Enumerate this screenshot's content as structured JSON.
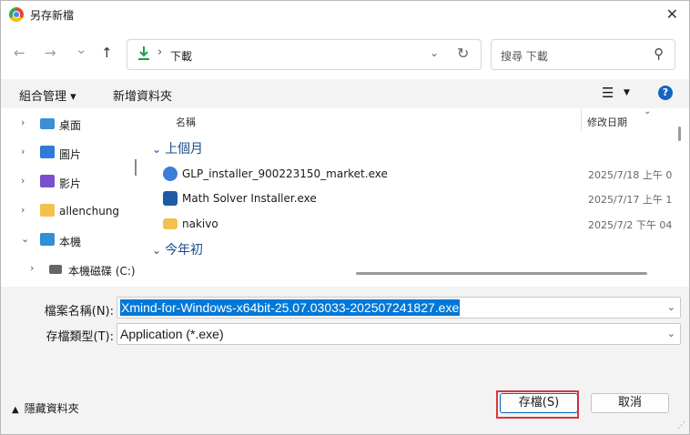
{
  "window": {
    "title": "另存新檔",
    "close_glyph": "✕"
  },
  "nav": {
    "back_glyph": "←",
    "forward_glyph": "→",
    "recent_glyph": "⌄",
    "up_glyph": "↑",
    "address": {
      "separator": "›",
      "location": "下載",
      "dropdown_glyph": "⌄",
      "refresh_glyph": "↻"
    },
    "search": {
      "placeholder": "搜尋 下載",
      "icon_glyph": "⚲"
    }
  },
  "toolbar": {
    "organize": "組合管理 ▾",
    "new_folder": "新增資料夾",
    "view_glyph": "☰",
    "view_caret": "▼",
    "help": "?"
  },
  "sidebar": {
    "items": [
      {
        "label": "桌面",
        "chevron": "›",
        "icon": "desktop-icon",
        "color": "#3a8fd8"
      },
      {
        "label": "圖片",
        "chevron": "›",
        "icon": "pictures-icon",
        "color": "#2f7bd6"
      },
      {
        "label": "影片",
        "chevron": "›",
        "icon": "videos-icon",
        "color": "#7a4fd0"
      },
      {
        "label": "allenchung",
        "chevron": "›",
        "icon": "folder-icon",
        "color": "#f2c14e"
      },
      {
        "label": "本機",
        "chevron": "⌄",
        "icon": "computer-icon",
        "color": "#2f8fd8"
      },
      {
        "label": "本機磁碟 (C:)",
        "chevron": "›",
        "icon": "drive-icon",
        "color": "#666666"
      }
    ]
  },
  "list": {
    "columns": {
      "name": "名稱",
      "date": "修改日期",
      "sort_glyph": "⌄"
    },
    "groups": [
      {
        "label": "上個月",
        "chevron": "⌄"
      },
      {
        "label": "今年初",
        "chevron": "⌄"
      }
    ],
    "rows": [
      {
        "name": "GLP_installer_900223150_market.exe",
        "date": "2025/7/18 上午 0",
        "icon": "installer-icon",
        "color": "#3b7dd8"
      },
      {
        "name": "Math Solver Installer.exe",
        "date": "2025/7/17 上午 1",
        "icon": "download-installer-icon",
        "color": "#1e5aa8"
      },
      {
        "name": "nakivo",
        "date": "2025/7/2 下午 04",
        "icon": "folder-icon",
        "color": "#f2c14e"
      }
    ]
  },
  "fields": {
    "filename_label": "檔案名稱(N):",
    "filename_value": "Xmind-for-Windows-x64bit-25.07.03033-202507241827.exe",
    "filetype_label": "存檔類型(T):",
    "filetype_value": "Application (*.exe)",
    "caret": "⌄"
  },
  "footer": {
    "hide_folders": "隱藏資料夾",
    "hide_caret": "▲",
    "save": "存檔(S)",
    "cancel": "取消",
    "grip": "⋰"
  },
  "colors": {
    "accent": "#0078d7",
    "highlight_ring": "#d9363e"
  }
}
